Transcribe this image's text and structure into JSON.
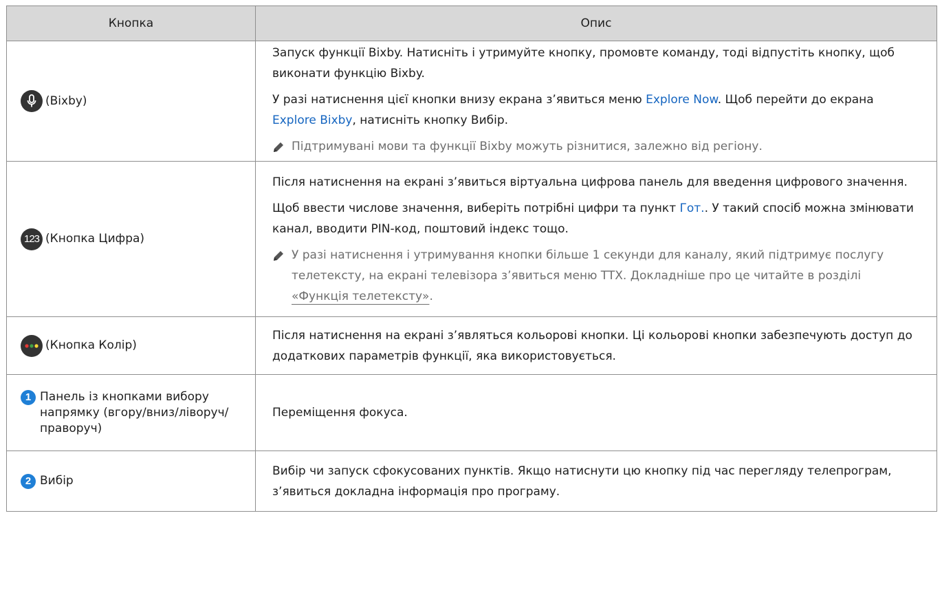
{
  "header": {
    "col_button": "Кнопка",
    "col_description": "Опис"
  },
  "rows": [
    {
      "icon": "microphone-icon",
      "label": "(Bixby)",
      "p1": "Запуск функції Bixby. Натисніть і утримуйте кнопку, промовте команду, тоді відпустіть кнопку, щоб виконати функцію Bixby.",
      "p2_a": "У разі натиснення цієї кнопки внизу екрана з’явиться меню ",
      "p2_link1": "Explore Now",
      "p2_b": ". Щоб перейти до екрана ",
      "p2_link2": "Explore Bixby",
      "p2_c": ", натисніть кнопку Вибір.",
      "note": "Підтримувані мови та функції Bixby можуть різнитися, залежно від регіону."
    },
    {
      "icon": "number-123-icon",
      "icon_text": "123",
      "label": "(Кнопка Цифра)",
      "p1": "Після натиснення на екрані з’явиться віртуальна цифрова панель для введення цифрового значення.",
      "p2_a": "Щоб ввести числове значення, виберіть потрібні цифри та пункт ",
      "p2_link": "Гот.",
      "p2_b": ". У такий спосіб можна змінювати канал, вводити PIN-код, поштовий індекс тощо.",
      "note_a": "У разі натиснення і утримування кнопки більше 1 секунди для каналу, який підтримує послугу телетексту, на екрані телевізора з’явиться меню TTX. Докладніше про це читайте в розділі ",
      "note_ref": "«Функція телетексту»",
      "note_b": "."
    },
    {
      "icon": "color-buttons-icon",
      "label": "(Кнопка Колір)",
      "p1": "Після натиснення на екрані з’являться кольорові кнопки. Ці кольорові кнопки забезпечують доступ до додаткових параметрів функції, яка використовується."
    },
    {
      "badge": "1",
      "label": "Панель із кнопками вибору напрямку (вгору/вниз/ліворуч/праворуч)",
      "p1": "Переміщення фокуса."
    },
    {
      "badge": "2",
      "label": "Вибір",
      "p1": "Вибір чи запуск сфокусованих пунктів. Якщо натиснути цю кнопку під час перегляду телепрограм, з’явиться докладна інформація про програму."
    }
  ],
  "colors": {
    "header_bg": "#d8d8d8",
    "link": "#1565c0",
    "badge": "#1f7fd6",
    "note_text": "#6e6e6e",
    "border": "#8e8e8e"
  }
}
